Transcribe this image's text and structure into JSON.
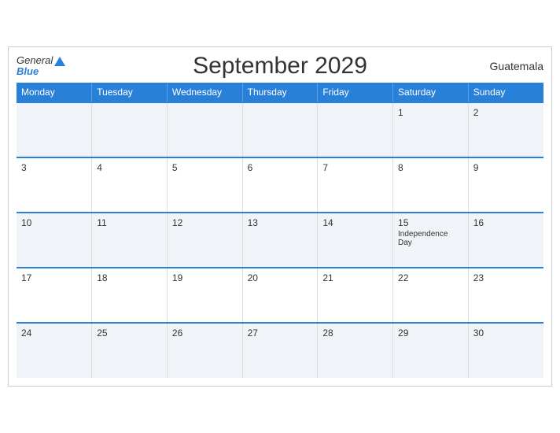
{
  "header": {
    "title": "September 2029",
    "country": "Guatemala",
    "logo_general": "General",
    "logo_blue": "Blue"
  },
  "weekdays": [
    "Monday",
    "Tuesday",
    "Wednesday",
    "Thursday",
    "Friday",
    "Saturday",
    "Sunday"
  ],
  "weeks": [
    [
      {
        "day": "",
        "event": ""
      },
      {
        "day": "",
        "event": ""
      },
      {
        "day": "",
        "event": ""
      },
      {
        "day": "",
        "event": ""
      },
      {
        "day": "",
        "event": ""
      },
      {
        "day": "1",
        "event": ""
      },
      {
        "day": "2",
        "event": ""
      }
    ],
    [
      {
        "day": "3",
        "event": ""
      },
      {
        "day": "4",
        "event": ""
      },
      {
        "day": "5",
        "event": ""
      },
      {
        "day": "6",
        "event": ""
      },
      {
        "day": "7",
        "event": ""
      },
      {
        "day": "8",
        "event": ""
      },
      {
        "day": "9",
        "event": ""
      }
    ],
    [
      {
        "day": "10",
        "event": ""
      },
      {
        "day": "11",
        "event": ""
      },
      {
        "day": "12",
        "event": ""
      },
      {
        "day": "13",
        "event": ""
      },
      {
        "day": "14",
        "event": ""
      },
      {
        "day": "15",
        "event": "Independence Day"
      },
      {
        "day": "16",
        "event": ""
      }
    ],
    [
      {
        "day": "17",
        "event": ""
      },
      {
        "day": "18",
        "event": ""
      },
      {
        "day": "19",
        "event": ""
      },
      {
        "day": "20",
        "event": ""
      },
      {
        "day": "21",
        "event": ""
      },
      {
        "day": "22",
        "event": ""
      },
      {
        "day": "23",
        "event": ""
      }
    ],
    [
      {
        "day": "24",
        "event": ""
      },
      {
        "day": "25",
        "event": ""
      },
      {
        "day": "26",
        "event": ""
      },
      {
        "day": "27",
        "event": ""
      },
      {
        "day": "28",
        "event": ""
      },
      {
        "day": "29",
        "event": ""
      },
      {
        "day": "30",
        "event": ""
      }
    ]
  ]
}
